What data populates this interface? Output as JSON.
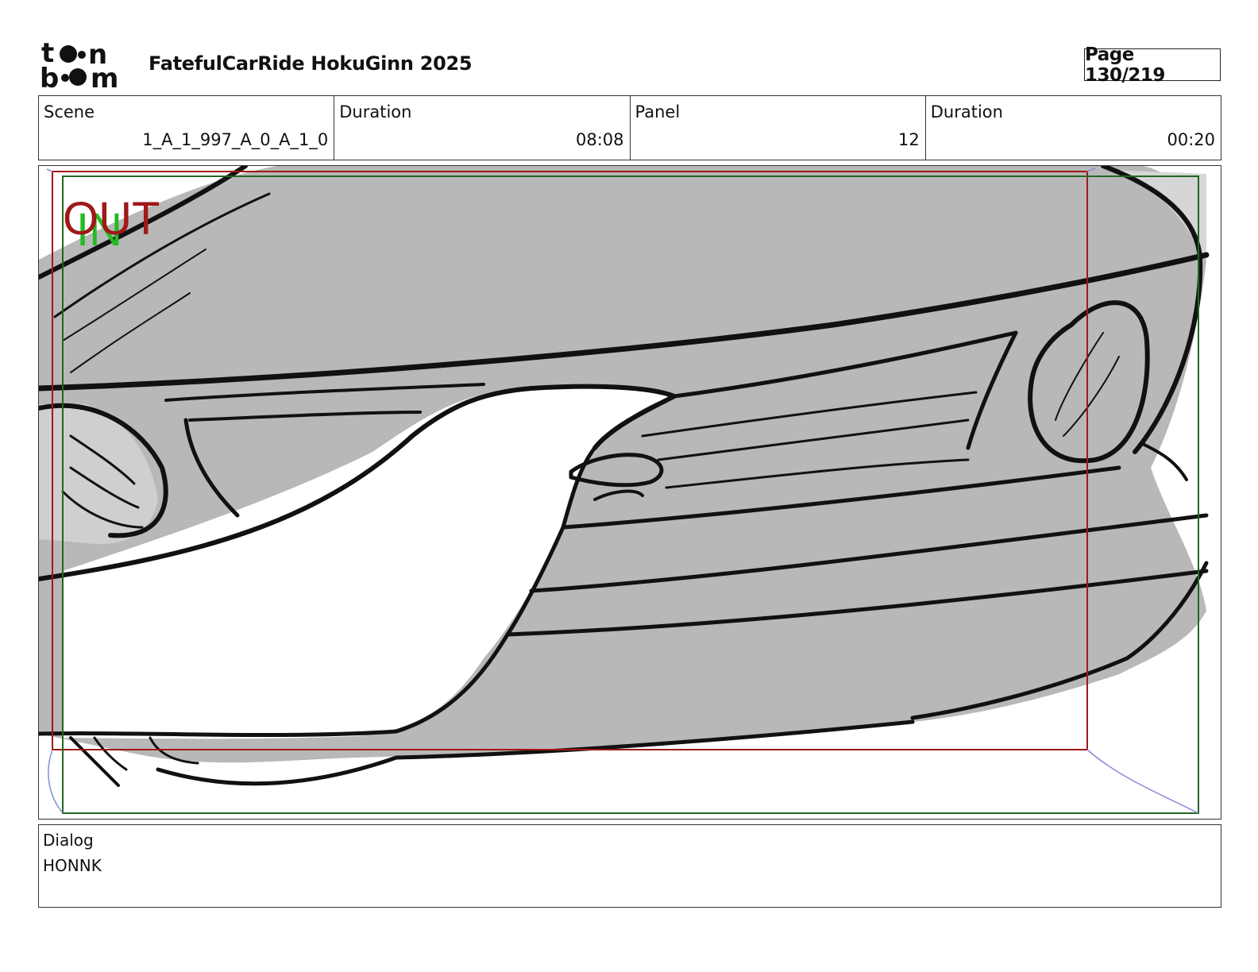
{
  "header": {
    "logo_alt": "toonboom",
    "project_title": "FatefulCarRide HokuGinn 2025",
    "page_label": "Page 130/219"
  },
  "info": {
    "scene_label": "Scene",
    "scene_value": "1_A_1_997_A_0_A_1_0",
    "scene_duration_label": "Duration",
    "scene_duration_value": "08:08",
    "panel_label": "Panel",
    "panel_value": "12",
    "panel_duration_label": "Duration",
    "panel_duration_value": "00:20"
  },
  "panel": {
    "out_marker": "OUT",
    "in_marker": "IN",
    "out_color": "#a01818",
    "in_color": "#22bb22"
  },
  "dialog": {
    "label": "Dialog",
    "text": "HONNK"
  }
}
